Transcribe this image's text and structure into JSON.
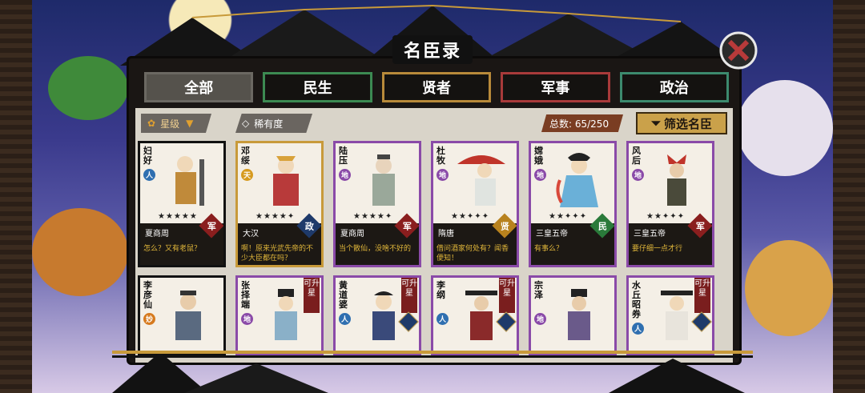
{
  "window": {
    "title": "名臣录"
  },
  "tabs": [
    {
      "label": "全部",
      "active": true
    },
    {
      "label": "民生",
      "active": false
    },
    {
      "label": "贤者",
      "active": false
    },
    {
      "label": "军事",
      "active": false
    },
    {
      "label": "政治",
      "active": false
    }
  ],
  "filters": {
    "star_label": "星级",
    "rarity_label": "稀有度",
    "total_text": "总数: 65/250",
    "filter_button": "筛选名臣"
  },
  "cards_top": [
    {
      "name": "妇好",
      "class_badge": "人",
      "class_color": "#2f6fb0",
      "stars": "★★★★★",
      "era": "夏商周",
      "role": "军",
      "role_color": "#8a1e1e",
      "quote": "怎么？又有老鼠？",
      "frame": "black"
    },
    {
      "name": "邓绥",
      "class_badge": "天",
      "class_color": "#d69a1e",
      "stars": "★★★★✦",
      "era": "大汉",
      "role": "政",
      "role_color": "#1e3a6a",
      "quote": "啊！原来光武先帝的不少大臣都在吗？",
      "frame": "gold"
    },
    {
      "name": "陆压",
      "class_badge": "地",
      "class_color": "#8a4aa8",
      "stars": "★★★★✦",
      "era": "夏商周",
      "role": "军",
      "role_color": "#8a1e1e",
      "quote": "当个散仙，没啥不好的",
      "frame": "purple"
    },
    {
      "name": "杜牧",
      "class_badge": "地",
      "class_color": "#8a4aa8",
      "stars": "★★✦✦✦",
      "era": "隋唐",
      "role": "贤",
      "role_color": "#b8821e",
      "quote": "借问酒家何处有？闻香便知！",
      "frame": "purple"
    },
    {
      "name": "嫦娥",
      "class_badge": "地",
      "class_color": "#8a4aa8",
      "stars": "★★✦✦✦",
      "era": "三皇五帝",
      "role": "民",
      "role_color": "#2a7a3a",
      "quote": "有事么？",
      "frame": "purple"
    },
    {
      "name": "风后",
      "class_badge": "地",
      "class_color": "#8a4aa8",
      "stars": "★★✦✦✦",
      "era": "三皇五帝",
      "role": "军",
      "role_color": "#8a1e1e",
      "quote": "要仔细一点才行",
      "frame": "purple"
    }
  ],
  "cards_bottom": [
    {
      "name": "李彦仙",
      "class_badge": "妙",
      "class_color": "#d67a1e",
      "upgrade": "",
      "frame": "black"
    },
    {
      "name": "张择端",
      "class_badge": "地",
      "class_color": "#8a4aa8",
      "upgrade": "可升星",
      "frame": "purple"
    },
    {
      "name": "黄道婆",
      "class_badge": "人",
      "class_color": "#2f6fb0",
      "upgrade": "可升星",
      "frame": "purple"
    },
    {
      "name": "李纲",
      "class_badge": "人",
      "class_color": "#2f6fb0",
      "upgrade": "可升星",
      "frame": "purple"
    },
    {
      "name": "宗泽",
      "class_badge": "地",
      "class_color": "#8a4aa8",
      "upgrade": "",
      "frame": "purple"
    },
    {
      "name": "水丘昭券",
      "class_badge": "人",
      "class_color": "#2f6fb0",
      "upgrade": "可升星",
      "frame": "purple"
    }
  ]
}
